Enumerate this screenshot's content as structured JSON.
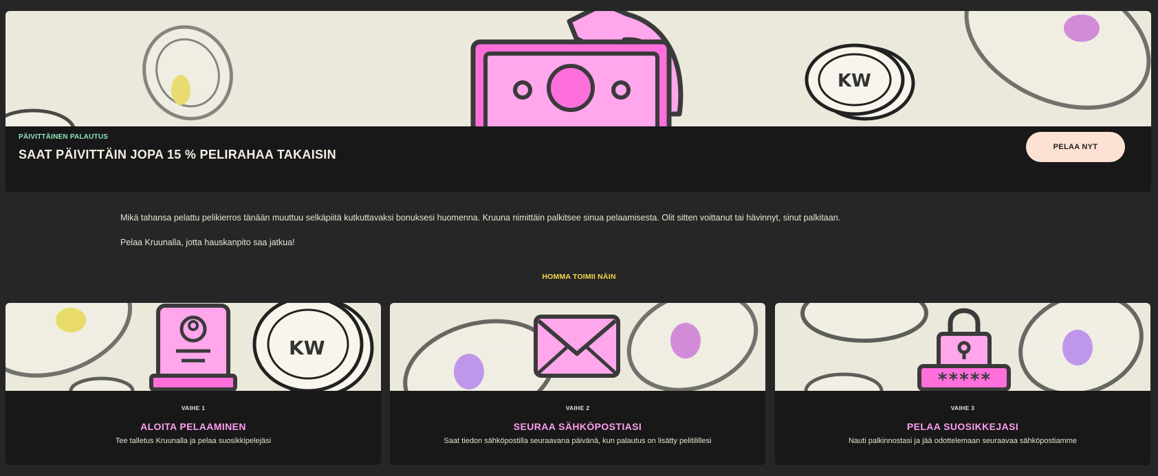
{
  "hero": {
    "kicker": "PÄIVITTÄINEN PALAUTUS",
    "title": "SAAT PÄIVITTÄIN JOPA 15 % PELIRAHAA TAKAISIN",
    "cta_label": "PELAA NYT",
    "illustration": "money-cashback-icon"
  },
  "description": {
    "paragraph_1": "Mikä tahansa pelattu pelikierros tänään muuttuu selkäpiitä kutkuttavaksi bonuksesi huomenna. Kruuna nimittäin palkitsee sinua pelaamisesta. Olit sitten voittanut tai hävinnyt, sinut palkitaan.",
    "paragraph_2": "Pelaa Kruunalla, jotta hauskanpito saa jatkua!"
  },
  "how_it_works": {
    "heading": "HOMMA TOIMII NÄIN",
    "steps": [
      {
        "step": "VAIHE 1",
        "title": "ALOITA PELAAMINEN",
        "text": "Tee talletus Kruunalla ja pelaa suosikkipelejäsi",
        "icon": "laptop-user-icon"
      },
      {
        "step": "VAIHE 2",
        "title": "SEURAA SÄHKÖPOSTIASI",
        "text": "Saat tiedon sähköpostilla seuraavana päivänä, kun palautus on lisätty pelitilillesi",
        "icon": "envelope-icon"
      },
      {
        "step": "VAIHE 3",
        "title": "PELAA SUOSIKKEJASI",
        "text": "Nauti palkinnostasi ja jää odottelemaan seuraavaa sähköpostiamme",
        "icon": "padlock-password-icon"
      }
    ]
  },
  "colors": {
    "page_bg": "#262626",
    "panel_bg": "#181818",
    "banner_bg": "#ebe9dc",
    "accent_pink": "#ff9ef0",
    "kicker_green": "#8de6b8",
    "heading_yellow": "#f5d84a",
    "cta_bg": "#fde1d2"
  }
}
